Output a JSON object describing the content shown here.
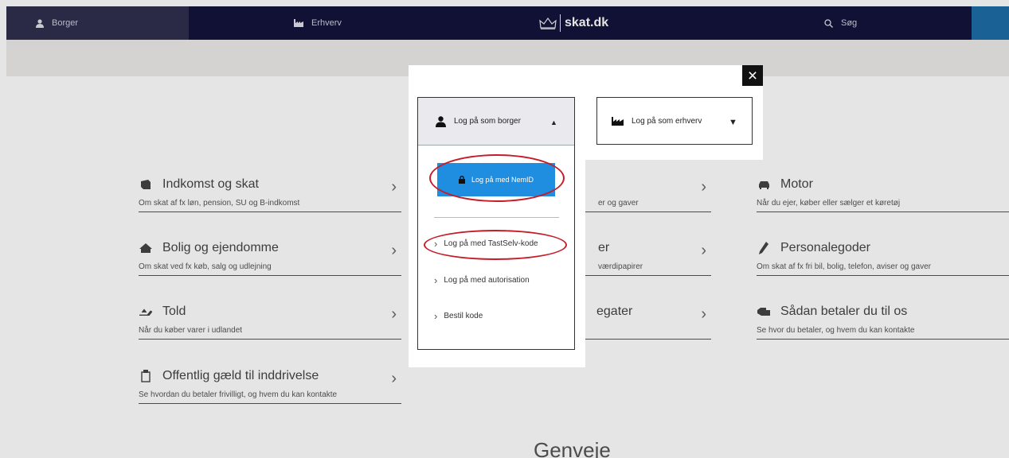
{
  "nav": {
    "borger": "Borger",
    "erhverv": "Erhverv",
    "logo": "skat.dk",
    "search": "Søg"
  },
  "cards": [
    {
      "title": "Indkomst og skat",
      "sub": "Om skat af fx løn, pension, SU og B-indkomst",
      "icon": "income-icon"
    },
    {
      "title": "Bolig og ejendomme",
      "sub": "Om skat ved fx køb, salg og udlejning",
      "icon": "house-icon"
    },
    {
      "title": "Told",
      "sub": "Når du køber varer i udlandet",
      "icon": "customs-icon"
    },
    {
      "title": "Offentlig gæld til inddrivelse",
      "sub": "Se hvordan du betaler frivilligt, og hvem du kan kontakte",
      "icon": "debt-icon"
    },
    {
      "title": "",
      "sub": "er og gaver",
      "icon": ""
    },
    {
      "title": "er",
      "sub": "værdipapirer",
      "icon": ""
    },
    {
      "title": "egater",
      "sub": "",
      "icon": ""
    },
    {
      "title": "Motor",
      "sub": "Når du ejer, køber eller sælger et køretøj",
      "icon": "car-icon"
    },
    {
      "title": "Personalegoder",
      "sub": "Om skat af fx fri bil, bolig, telefon, aviser og gaver",
      "icon": "pen-icon"
    },
    {
      "title": "Sådan betaler du til os",
      "sub": "Se hvor du betaler, og hvem du kan kontakte",
      "icon": "payment-icon"
    }
  ],
  "genveje": "Genveje",
  "modal": {
    "borger_tab": "Log på som borger",
    "erhverv_tab": "Log på som erhverv",
    "nemid": "Log på med NemID",
    "tastselv": "Log på med TastSelv-kode",
    "autorisation": "Log på med autorisation",
    "bestil": "Bestil kode",
    "close": "×"
  },
  "colors": {
    "nav_bg": "#14143c",
    "accent_blue": "#1f8ee0",
    "annotation_red": "#c61c28"
  }
}
